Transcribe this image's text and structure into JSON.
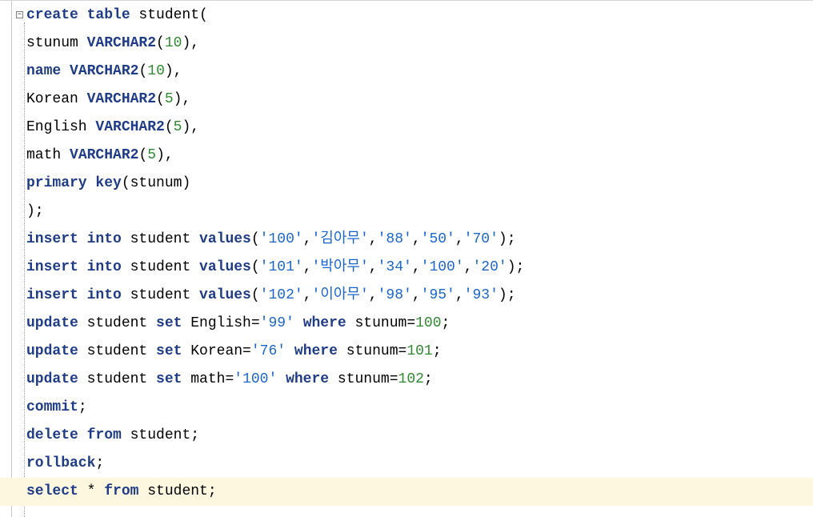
{
  "editor": {
    "fold_glyph": "⊟",
    "current_line_color": "#fdf7e0",
    "keyword_color": "#1f3c88",
    "number_color": "#2f8a2f",
    "string_color": "#1a66cc",
    "lines": [
      [
        {
          "t": "create table",
          "c": "kw"
        },
        {
          "t": " student(",
          "c": "txt"
        }
      ],
      [
        {
          "t": "stunum ",
          "c": "txt"
        },
        {
          "t": "VARCHAR2",
          "c": "kw"
        },
        {
          "t": "(",
          "c": "txt"
        },
        {
          "t": "10",
          "c": "num"
        },
        {
          "t": "),",
          "c": "txt"
        }
      ],
      [
        {
          "t": "name",
          "c": "kw"
        },
        {
          "t": " ",
          "c": "txt"
        },
        {
          "t": "VARCHAR2",
          "c": "kw"
        },
        {
          "t": "(",
          "c": "txt"
        },
        {
          "t": "10",
          "c": "num"
        },
        {
          "t": "),",
          "c": "txt"
        }
      ],
      [
        {
          "t": "Korean ",
          "c": "txt"
        },
        {
          "t": "VARCHAR2",
          "c": "kw"
        },
        {
          "t": "(",
          "c": "txt"
        },
        {
          "t": "5",
          "c": "num"
        },
        {
          "t": "),",
          "c": "txt"
        }
      ],
      [
        {
          "t": "English ",
          "c": "txt"
        },
        {
          "t": "VARCHAR2",
          "c": "kw"
        },
        {
          "t": "(",
          "c": "txt"
        },
        {
          "t": "5",
          "c": "num"
        },
        {
          "t": "),",
          "c": "txt"
        }
      ],
      [
        {
          "t": "math ",
          "c": "txt"
        },
        {
          "t": "VARCHAR2",
          "c": "kw"
        },
        {
          "t": "(",
          "c": "txt"
        },
        {
          "t": "5",
          "c": "num"
        },
        {
          "t": "),",
          "c": "txt"
        }
      ],
      [
        {
          "t": "primary key",
          "c": "kw"
        },
        {
          "t": "(stunum)",
          "c": "txt"
        }
      ],
      [
        {
          "t": ");",
          "c": "txt"
        }
      ],
      [
        {
          "t": "insert into",
          "c": "kw"
        },
        {
          "t": " student ",
          "c": "txt"
        },
        {
          "t": "values",
          "c": "kw"
        },
        {
          "t": "(",
          "c": "txt"
        },
        {
          "t": "'100'",
          "c": "str"
        },
        {
          "t": ",",
          "c": "txt"
        },
        {
          "t": "'김아무'",
          "c": "str"
        },
        {
          "t": ",",
          "c": "txt"
        },
        {
          "t": "'88'",
          "c": "str"
        },
        {
          "t": ",",
          "c": "txt"
        },
        {
          "t": "'50'",
          "c": "str"
        },
        {
          "t": ",",
          "c": "txt"
        },
        {
          "t": "'70'",
          "c": "str"
        },
        {
          "t": ");",
          "c": "txt"
        }
      ],
      [
        {
          "t": "insert into",
          "c": "kw"
        },
        {
          "t": " student ",
          "c": "txt"
        },
        {
          "t": "values",
          "c": "kw"
        },
        {
          "t": "(",
          "c": "txt"
        },
        {
          "t": "'101'",
          "c": "str"
        },
        {
          "t": ",",
          "c": "txt"
        },
        {
          "t": "'박아무'",
          "c": "str"
        },
        {
          "t": ",",
          "c": "txt"
        },
        {
          "t": "'34'",
          "c": "str"
        },
        {
          "t": ",",
          "c": "txt"
        },
        {
          "t": "'100'",
          "c": "str"
        },
        {
          "t": ",",
          "c": "txt"
        },
        {
          "t": "'20'",
          "c": "str"
        },
        {
          "t": ");",
          "c": "txt"
        }
      ],
      [
        {
          "t": "insert into",
          "c": "kw"
        },
        {
          "t": " student ",
          "c": "txt"
        },
        {
          "t": "values",
          "c": "kw"
        },
        {
          "t": "(",
          "c": "txt"
        },
        {
          "t": "'102'",
          "c": "str"
        },
        {
          "t": ",",
          "c": "txt"
        },
        {
          "t": "'이아무'",
          "c": "str"
        },
        {
          "t": ",",
          "c": "txt"
        },
        {
          "t": "'98'",
          "c": "str"
        },
        {
          "t": ",",
          "c": "txt"
        },
        {
          "t": "'95'",
          "c": "str"
        },
        {
          "t": ",",
          "c": "txt"
        },
        {
          "t": "'93'",
          "c": "str"
        },
        {
          "t": ");",
          "c": "txt"
        }
      ],
      [
        {
          "t": "update",
          "c": "kw"
        },
        {
          "t": " student ",
          "c": "txt"
        },
        {
          "t": "set",
          "c": "kw"
        },
        {
          "t": " English=",
          "c": "txt"
        },
        {
          "t": "'99'",
          "c": "str"
        },
        {
          "t": " ",
          "c": "txt"
        },
        {
          "t": "where",
          "c": "kw"
        },
        {
          "t": " stunum=",
          "c": "txt"
        },
        {
          "t": "100",
          "c": "num"
        },
        {
          "t": ";",
          "c": "txt"
        }
      ],
      [
        {
          "t": "update",
          "c": "kw"
        },
        {
          "t": " student ",
          "c": "txt"
        },
        {
          "t": "set",
          "c": "kw"
        },
        {
          "t": " Korean=",
          "c": "txt"
        },
        {
          "t": "'76'",
          "c": "str"
        },
        {
          "t": " ",
          "c": "txt"
        },
        {
          "t": "where",
          "c": "kw"
        },
        {
          "t": " stunum=",
          "c": "txt"
        },
        {
          "t": "101",
          "c": "num"
        },
        {
          "t": ";",
          "c": "txt"
        }
      ],
      [
        {
          "t": "update",
          "c": "kw"
        },
        {
          "t": " student ",
          "c": "txt"
        },
        {
          "t": "set",
          "c": "kw"
        },
        {
          "t": " math=",
          "c": "txt"
        },
        {
          "t": "'100'",
          "c": "str"
        },
        {
          "t": " ",
          "c": "txt"
        },
        {
          "t": "where",
          "c": "kw"
        },
        {
          "t": " stunum=",
          "c": "txt"
        },
        {
          "t": "102",
          "c": "num"
        },
        {
          "t": ";",
          "c": "txt"
        }
      ],
      [
        {
          "t": "commit",
          "c": "kw"
        },
        {
          "t": ";",
          "c": "txt"
        }
      ],
      [
        {
          "t": "delete from",
          "c": "kw"
        },
        {
          "t": " student;",
          "c": "txt"
        }
      ],
      [
        {
          "t": "rollback",
          "c": "kw"
        },
        {
          "t": ";",
          "c": "txt"
        }
      ],
      [
        {
          "t": "select",
          "c": "kw"
        },
        {
          "t": " * ",
          "c": "txt"
        },
        {
          "t": "from",
          "c": "kw"
        },
        {
          "t": " student;",
          "c": "txt"
        }
      ]
    ],
    "current_line": 17
  }
}
